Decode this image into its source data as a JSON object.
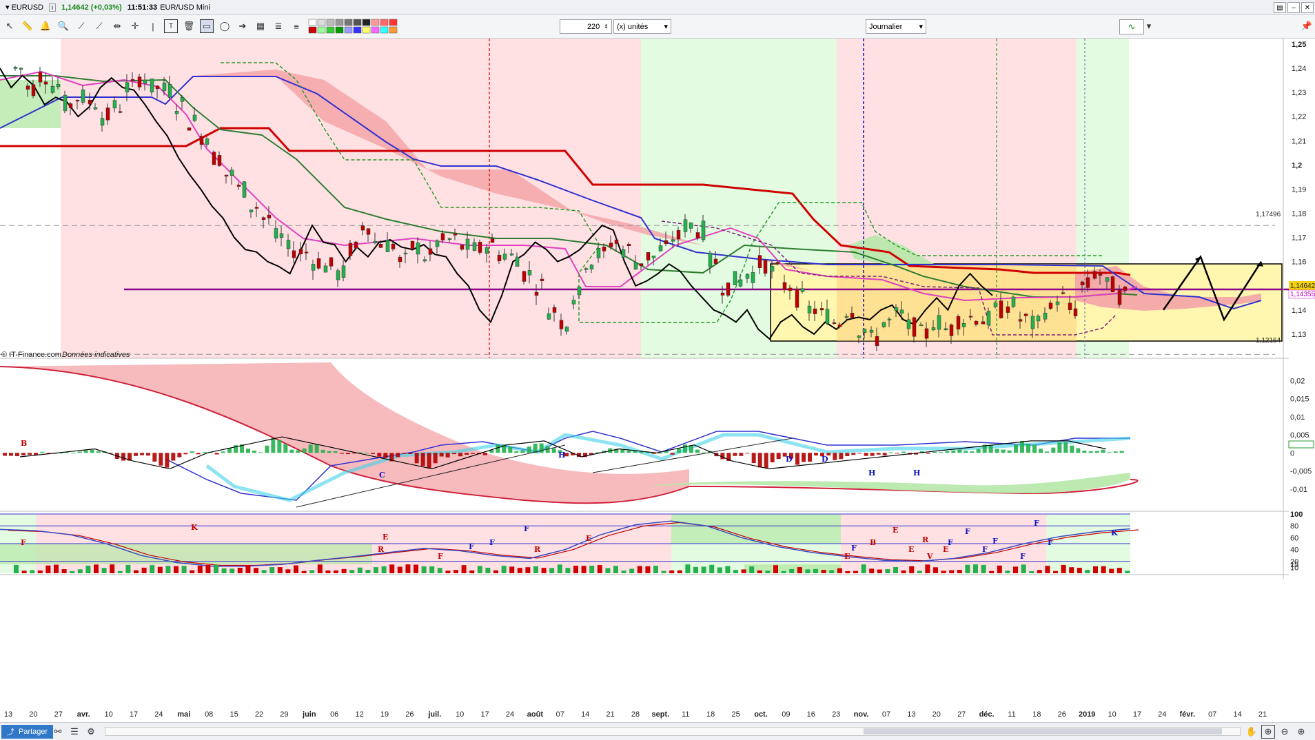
{
  "header": {
    "symbol": "EURUSD",
    "info_icon": "info-icon",
    "price_change": "1,14642 (+0,03%)",
    "time": "11:51:33",
    "instrument": "EUR/USD Mini"
  },
  "toolbar": {
    "count_value": "220",
    "units_label": "(x) unités",
    "period_label": "Journalier",
    "icons": [
      "cursor-icon",
      "ruler-icon",
      "bell-icon",
      "zoom-icon",
      "line-icon",
      "trend-icon",
      "horizontal-line-icon",
      "cross-icon",
      "text-icon",
      "trash-icon",
      "rectangle-icon",
      "lasso-icon",
      "arrow-icon",
      "grid-icon",
      "fibonacci-icon",
      "palette-icon",
      "indicator-icon"
    ]
  },
  "colors": {
    "bull": "#22b14c",
    "bear": "#c00000",
    "kijun": "#d00000",
    "tenkan": "#2e7d32",
    "spanA": "#e040c0",
    "spanB": "#3030d0",
    "chikou": "#000000",
    "kumo_bear": "#f4a4a8",
    "kumo_bull": "#b6e8a8",
    "pink_zone": "#ffe1e3",
    "green_zone": "#e3fbe1",
    "box_fill": "#fff6b0"
  },
  "chart": {
    "copyright": "© IT-Finance.com",
    "notice": "Données indicatives",
    "price_labels": {
      "current": "1,14642",
      "secondary": "1,14355",
      "upper": "1,17496",
      "lower": "1,12164"
    }
  },
  "chart_data": [
    {
      "type": "line",
      "title": "",
      "series": [
        {
          "name": "EURUSD",
          "values": [
            1.24,
            1.232,
            1.237,
            1.233,
            1.225,
            1.228,
            1.226,
            1.22,
            1.224,
            1.232,
            1.236,
            1.232,
            1.231,
            1.225,
            1.218,
            1.212,
            1.203,
            1.196,
            1.19,
            1.183,
            1.178,
            1.17,
            1.165,
            1.164,
            1.16,
            1.158,
            1.155,
            1.165,
            1.175,
            1.168,
            1.167,
            1.16,
            1.166,
            1.162,
            1.168,
            1.169,
            1.166,
            1.165,
            1.167,
            1.163,
            1.162,
            1.155,
            1.15,
            1.14,
            1.135,
            1.146,
            1.16,
            1.163,
            1.168,
            1.165,
            1.16,
            1.162,
            1.165,
            1.17,
            1.175,
            1.173,
            1.16,
            1.15,
            1.152,
            1.155,
            1.159,
            1.156,
            1.15,
            1.145,
            1.14,
            1.138,
            1.135,
            1.14,
            1.132,
            1.128,
            1.135,
            1.138,
            1.133,
            1.13,
            1.135,
            1.132,
            1.136,
            1.137,
            1.136,
            1.14,
            1.142,
            1.136,
            1.134,
            1.14,
            1.145,
            1.14,
            1.15,
            1.155,
            1.15,
            1.146
          ]
        }
      ],
      "ylim": [
        1.12,
        1.25
      ],
      "y_ticks": [
        "1,25",
        "1,24",
        "1,23",
        "1,22",
        "1,21",
        "1,2",
        "1,19",
        "1,18",
        "1,17",
        "1,16",
        "1,15",
        "1,14",
        "1,13"
      ],
      "projection": [
        1.14,
        1.162,
        1.136,
        1.16
      ],
      "horizontal_levels": [
        1.17496,
        1.1555,
        1.13,
        1.12164
      ],
      "grid": false
    },
    {
      "type": "line",
      "title": "",
      "series": [
        {
          "name": "",
          "values": [
            -0.001,
            0.0,
            0.001,
            -0.002,
            -0.004,
            0.0,
            0.002,
            0.004,
            0.002,
            0.0,
            -0.002,
            -0.004,
            -0.001,
            0.002,
            0.003,
            -0.001,
            0.001,
            0.0,
            0.002,
            -0.002,
            -0.004,
            -0.003,
            -0.002,
            -0.001,
            0.0,
            0.001,
            0.002,
            0.003,
            0.003,
            0.001
          ]
        }
      ],
      "ylim": [
        -0.015,
        0.025
      ],
      "y_ticks": [
        "0,02",
        "0,015",
        "0,01",
        "0,005",
        "0",
        "-0,005",
        "-0,01"
      ],
      "signals": [
        "B",
        "C",
        "H",
        "D",
        "D",
        "H",
        "H"
      ],
      "grid": false
    },
    {
      "type": "line",
      "title": "",
      "series": [
        {
          "name": "",
          "values": [
            74,
            72,
            65,
            50,
            30,
            18,
            12,
            12,
            15,
            22,
            28,
            35,
            42,
            38,
            30,
            25,
            40,
            65,
            82,
            88,
            80,
            60,
            45,
            35,
            28,
            22,
            20,
            25,
            35,
            50,
            62,
            70,
            75
          ]
        }
      ],
      "ylim": [
        0,
        100
      ],
      "y_ticks": [
        "100",
        "80",
        "60",
        "40",
        "20",
        "15",
        "10"
      ],
      "signals": [
        "F",
        "K",
        "R",
        "E",
        "F",
        "F",
        "F",
        "F",
        "R",
        "E",
        "E",
        "F",
        "B",
        "E",
        "E",
        "R",
        "V",
        "E",
        "F",
        "F",
        "F",
        "F",
        "F",
        "F",
        "F",
        "K"
      ],
      "grid": false
    }
  ],
  "x_axis": {
    "labels": [
      "13",
      "20",
      "27",
      "avr.",
      "10",
      "17",
      "24",
      "mai",
      "08",
      "15",
      "22",
      "29",
      "juin",
      "06",
      "12",
      "19",
      "26",
      "juil.",
      "10",
      "17",
      "24",
      "août",
      "07",
      "14",
      "21",
      "28",
      "sept.",
      "11",
      "18",
      "25",
      "oct.",
      "09",
      "16",
      "23",
      "nov.",
      "07",
      "13",
      "20",
      "27",
      "déc.",
      "11",
      "18",
      "26",
      "2019",
      "10",
      "17",
      "24",
      "févr.",
      "07",
      "14",
      "21"
    ]
  },
  "statusbar": {
    "share_label": "Partager"
  }
}
